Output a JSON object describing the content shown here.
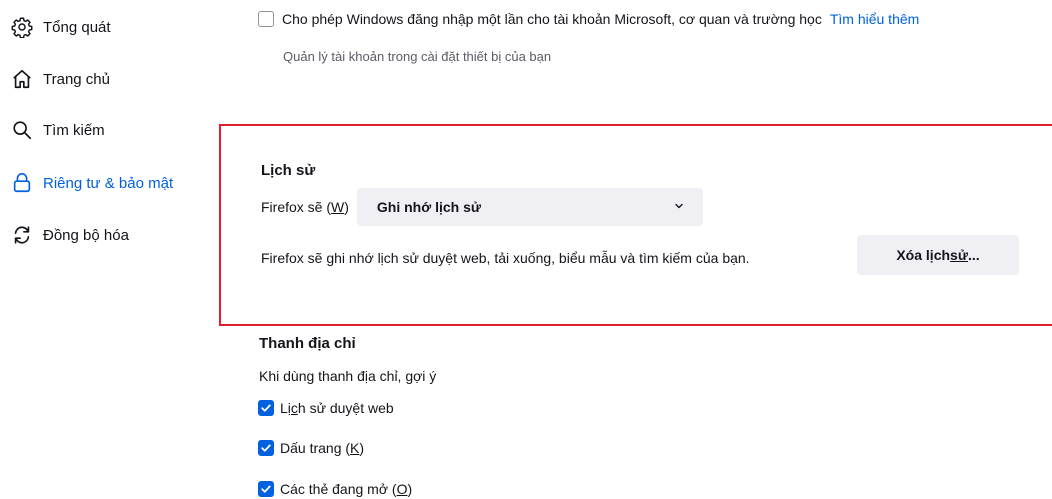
{
  "sidebar": {
    "items": [
      {
        "label": "Tổng quát",
        "icon": "gear-icon"
      },
      {
        "label": "Trang chủ",
        "icon": "home-icon"
      },
      {
        "label": "Tìm kiếm",
        "icon": "search-icon"
      },
      {
        "label": "Riêng tư & bảo mật",
        "icon": "lock-icon",
        "active": true
      },
      {
        "label": "Đồng bộ hóa",
        "icon": "sync-icon"
      }
    ]
  },
  "sso": {
    "checked": false,
    "label": "Cho phép Windows đăng nhập một lần cho tài khoản Microsoft, cơ quan và trường học",
    "link": "Tìm hiểu thêm",
    "description": "Quản lý tài khoản trong cài đặt thiết bị của bạn"
  },
  "history": {
    "heading": "Lịch sử",
    "firefox_prefix": "Firefox sẽ (",
    "firefox_accel": "W",
    "firefox_suffix": ")",
    "select_value": "Ghi nhớ lịch sử",
    "description": "Firefox sẽ ghi nhớ lịch sử duyệt web, tải xuống, biểu mẫu và tìm kiếm của bạn.",
    "clear_button_prefix": "Xóa lịch ",
    "clear_button_accel": "sử",
    "clear_button_suffix": "..."
  },
  "address_bar": {
    "heading": "Thanh địa chỉ",
    "description": "Khi dùng thanh địa chỉ, gợi ý",
    "options": [
      {
        "prefix": "Lị",
        "accel": "c",
        "suffix": "h sử duyệt web",
        "checked": true
      },
      {
        "prefix": "Dấu trang (",
        "accel": "K",
        "suffix": ")",
        "checked": true
      },
      {
        "prefix": "Các thẻ đang mở (",
        "accel": "O",
        "suffix": ")",
        "checked": true
      }
    ]
  },
  "colors": {
    "accent": "#0061e0",
    "highlight_border": "#e0202a",
    "button_bg": "#f0f0f4"
  }
}
